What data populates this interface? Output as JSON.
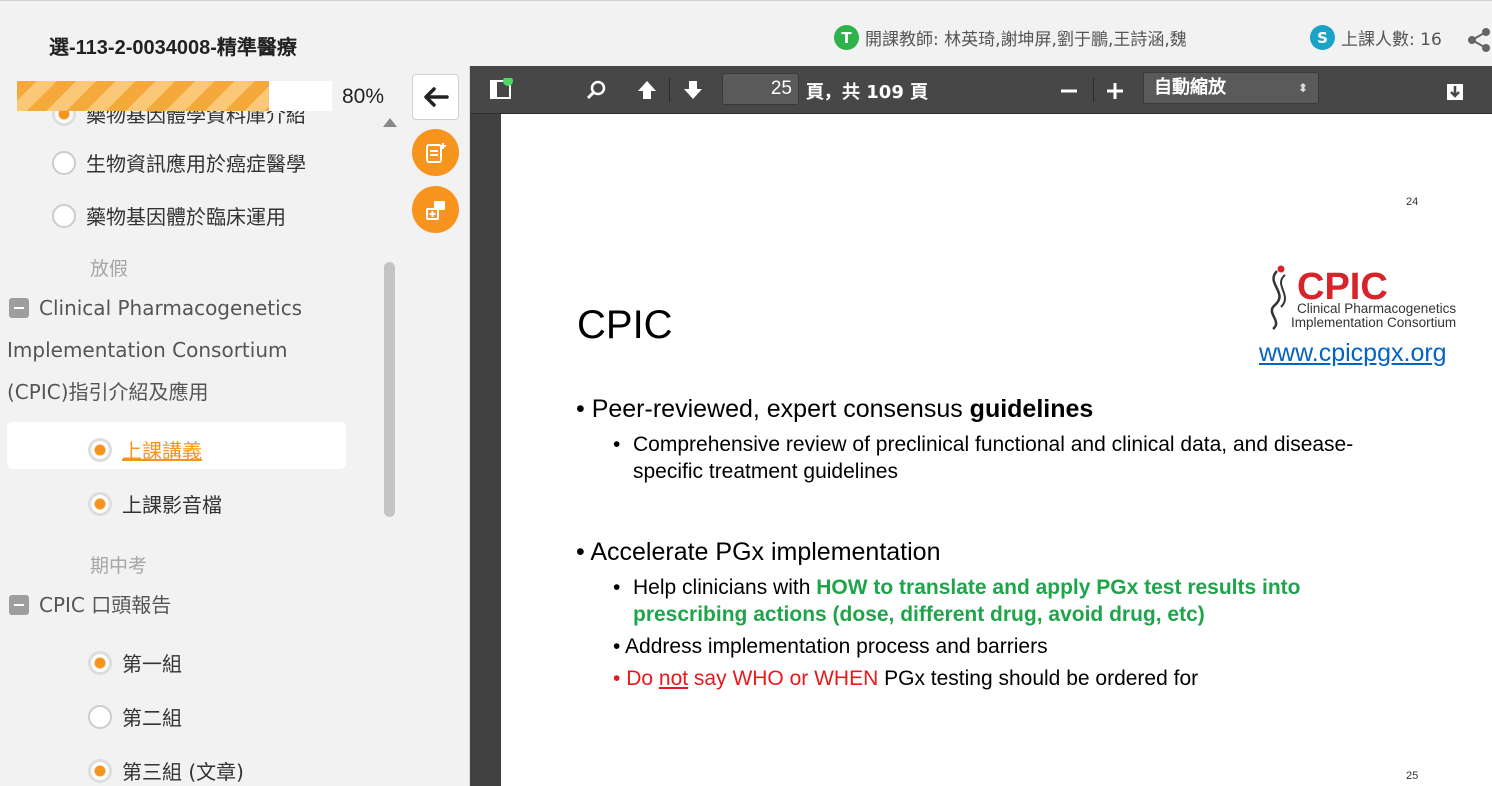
{
  "header": {
    "course_title": "選-113-2-0034008-精準醫療",
    "teacher_badge": "T",
    "teacher_text": "開課教師: 林英琦,謝坤屏,劉于鵬,王詩涵,魏",
    "student_badge": "S",
    "student_text": "上課人數: 16",
    "colors": {
      "teacher_badge": "#2db34a",
      "student_badge": "#1aa3c9"
    }
  },
  "sidebar": {
    "progress_text": "80%",
    "progress": 0.8,
    "items": [
      {
        "label": "藥物基因體學資料庫介紹"
      },
      {
        "label": "生物資訊應用於癌症醫學"
      },
      {
        "label": "藥物基因體於臨床運用"
      }
    ],
    "holiday": "放假",
    "section1_title": "Clinical Pharmacogenetics Implementation Consortium (CPIC)指引介紹及應用",
    "section1_items": [
      {
        "label": "上課講義"
      },
      {
        "label": "上課影音檔"
      }
    ],
    "midterm": "期中考",
    "section2_title": "CPIC 口頭報告",
    "section2_items": [
      {
        "label": "第一組"
      },
      {
        "label": "第二組"
      },
      {
        "label": "第三組 (文章)"
      }
    ]
  },
  "viewer": {
    "page_current": "25",
    "page_of": "頁，共 109 頁",
    "zoom": "自動縮放",
    "prev_page_number": "24",
    "page_number": "25"
  },
  "slide": {
    "title": "CPIC",
    "logo_main": "CPIC",
    "logo_line1": "Clinical Pharmacogenetics",
    "logo_line2": "Implementation Consortium",
    "url": "www.cpicpgx.org",
    "b1_text": "Peer-reviewed, expert consensus ",
    "b1_bold": "guidelines",
    "b1_sub": "Comprehensive review of preclinical functional and clinical data, and disease-specific treatment guidelines",
    "b2_text": "Accelerate PGx implementation",
    "b2_sub1_pre": "Help clinicians with ",
    "b2_sub1_green": "HOW to translate and apply PGx test results into prescribing actions (dose, different drug, avoid drug, etc)",
    "b2_sub2": "Address implementation process and barriers",
    "b2_sub3_red1": "Do ",
    "b2_sub3_red_u": "not",
    "b2_sub3_red2": " say WHO or WHEN",
    "b2_sub3_black": " PGx testing should be ordered for"
  }
}
